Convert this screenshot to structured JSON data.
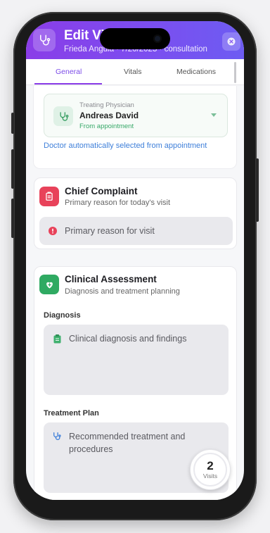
{
  "header": {
    "title": "Edit Vi",
    "subtitle": "Frieda Angula · 7/20/2025 · consultation",
    "icon": "stethoscope-icon",
    "close_icon": "close-icon",
    "gradient_start": "#8a3de8",
    "gradient_end": "#6d5cf2"
  },
  "tabs": [
    {
      "label": "General",
      "active": true
    },
    {
      "label": "Vitals",
      "active": false
    },
    {
      "label": "Medications",
      "active": false
    }
  ],
  "physician": {
    "label": "Treating Physician",
    "name": "Andreas David",
    "source": "From appointment",
    "note": "Doctor automatically selected from appointment"
  },
  "chief_complaint": {
    "title": "Chief Complaint",
    "subtitle": "Primary reason for today's visit",
    "placeholder": "Primary reason for visit",
    "accent": "#e8425a"
  },
  "clinical_assessment": {
    "title": "Clinical Assessment",
    "subtitle": "Diagnosis and treatment planning",
    "accent": "#2faa62",
    "diagnosis": {
      "label": "Diagnosis",
      "placeholder": "Clinical diagnosis and findings"
    },
    "treatment": {
      "label": "Treatment Plan",
      "placeholder": "Recommended treatment and procedures"
    }
  },
  "visits_badge": {
    "count": "2",
    "label": "Visits"
  }
}
